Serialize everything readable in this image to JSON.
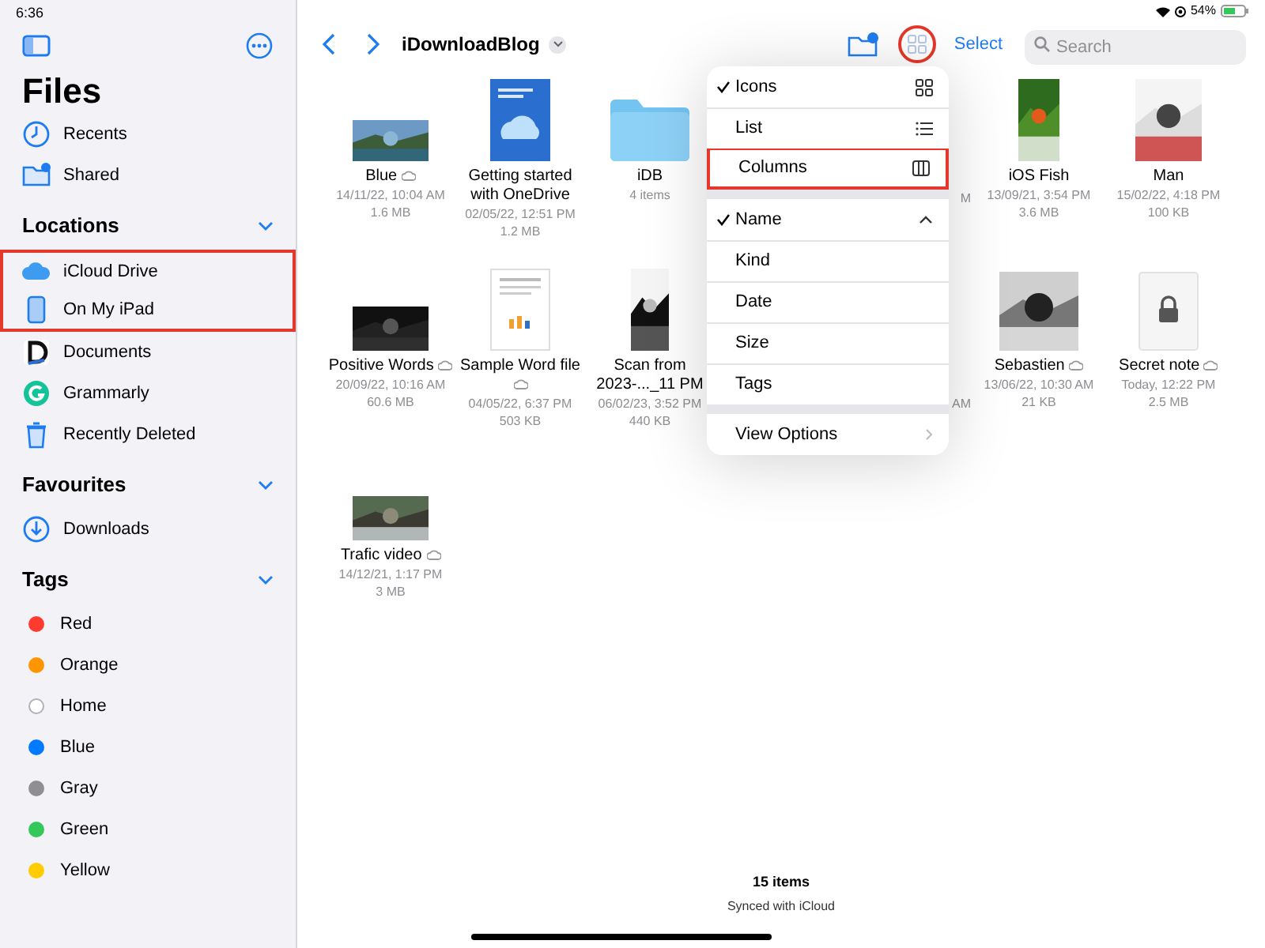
{
  "status_bar": {
    "time": "6:36",
    "battery": "54%"
  },
  "sidebar": {
    "title": "Files",
    "sections": [
      {
        "items": [
          {
            "label": "Recents",
            "highlighted": false
          },
          {
            "label": "Shared",
            "highlighted": false
          }
        ]
      },
      {
        "heading": "Locations",
        "expanded": true,
        "items": [
          {
            "label": "iCloud Drive",
            "highlighted": true
          },
          {
            "label": "On My iPad",
            "highlighted": true
          },
          {
            "label": "Documents",
            "highlighted": false
          },
          {
            "label": "Grammarly",
            "highlighted": false
          },
          {
            "label": "Recently Deleted",
            "highlighted": false
          }
        ]
      },
      {
        "heading": "Favourites",
        "expanded": true,
        "items": [
          {
            "label": "Downloads",
            "highlighted": false
          }
        ]
      },
      {
        "heading": "Tags",
        "expanded": true,
        "items": [
          {
            "label": "Red",
            "color": "#ff3b30"
          },
          {
            "label": "Orange",
            "color": "#ff9500"
          },
          {
            "label": "Home",
            "color": "#ffffff"
          },
          {
            "label": "Blue",
            "color": "#007aff"
          },
          {
            "label": "Gray",
            "color": "#8e8e93"
          },
          {
            "label": "Green",
            "color": "#34c759"
          },
          {
            "label": "Yellow",
            "color": "#ffcc00"
          }
        ]
      }
    ]
  },
  "toolbar": {
    "title": "iDownloadBlog",
    "view_button_highlighted": true,
    "select": "Select",
    "search": {
      "placeholder": "Search"
    }
  },
  "files": [
    {
      "kind": "picture",
      "name": "Blue",
      "cloud": true,
      "date": "14/11/22, 10:04 AM",
      "size": "1.6 MB"
    },
    {
      "kind": "document",
      "name": "Getting started with OneDrive",
      "cloud": false,
      "date": "02/05/22, 12:51 PM",
      "size": "1.2 MB"
    },
    {
      "kind": "folder",
      "name": "iDB",
      "cloud": false,
      "date": "4 items"
    },
    {
      "kind": "hidden"
    },
    {
      "kind": "hidden",
      "fragment": "M"
    },
    {
      "kind": "picture",
      "name": "iOS Fish",
      "cloud": false,
      "date": "13/09/21, 3:54 PM",
      "size": "3.6 MB"
    },
    {
      "kind": "picture",
      "name": "Man",
      "cloud": false,
      "date": "15/02/22, 4:18 PM",
      "size": "100 KB"
    },
    {
      "kind": "picture",
      "name": "Positive Words",
      "cloud": true,
      "date": "20/09/22, 10:16 AM",
      "size": "60.6 MB"
    },
    {
      "kind": "document",
      "name": "Sample Word file",
      "cloud": true,
      "date": "04/05/22, 6:37 PM",
      "size": "503 KB"
    },
    {
      "kind": "picture",
      "name": "Scan from 2023-..._11 PM",
      "cloud": false,
      "date": "06/02/23, 3:52 PM",
      "size": "440 KB"
    },
    {
      "kind": "hidden"
    },
    {
      "kind": "hidden",
      "fragment": "AM"
    },
    {
      "kind": "picture",
      "name": "Sebastien",
      "cloud": true,
      "date": "13/06/22, 10:30 AM",
      "size": "21 KB"
    },
    {
      "kind": "locked",
      "name": "Secret note",
      "cloud": true,
      "date": "Today, 12:22 PM",
      "size": "2.5 MB"
    },
    {
      "kind": "picture",
      "name": "Trafic video",
      "cloud": true,
      "date": "14/12/21, 1:17 PM",
      "size": "3 MB"
    }
  ],
  "view_menu": {
    "groups": [
      [
        {
          "label": "Icons",
          "selected": true,
          "highlighted": false
        },
        {
          "label": "List",
          "selected": false,
          "highlighted": false
        },
        {
          "label": "Columns",
          "selected": false,
          "highlighted": true
        }
      ],
      [
        {
          "label": "Name",
          "selected": true,
          "highlighted": false
        },
        {
          "label": "Kind",
          "selected": false,
          "highlighted": false
        },
        {
          "label": "Date",
          "selected": false,
          "highlighted": false
        },
        {
          "label": "Size",
          "selected": false,
          "highlighted": false
        },
        {
          "label": "Tags",
          "selected": false,
          "highlighted": false
        }
      ],
      [
        {
          "label": "View Options",
          "selected": false,
          "highlighted": false
        }
      ]
    ]
  },
  "footer": {
    "count": "15 items",
    "sync": "Synced with iCloud"
  }
}
